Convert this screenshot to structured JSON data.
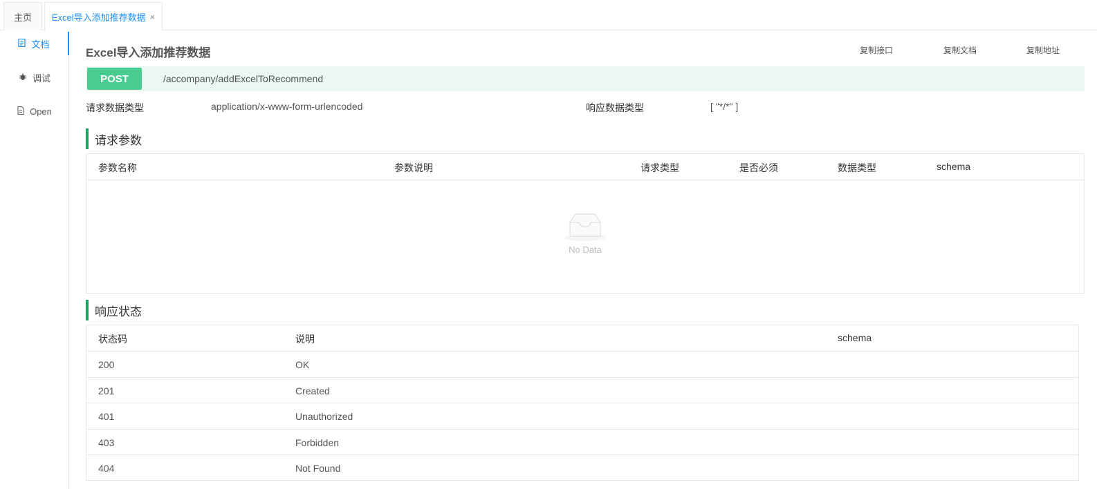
{
  "tabs": {
    "home": "主页",
    "active": "Excel导入添加推荐数据",
    "close": "×"
  },
  "sidebar": {
    "items": [
      {
        "label": "文档",
        "icon": "document-icon"
      },
      {
        "label": "调试",
        "icon": "bug-icon"
      },
      {
        "label": "Open",
        "icon": "file-icon"
      }
    ]
  },
  "api": {
    "title": "Excel导入添加推荐数据",
    "copy_interface": "复制接口",
    "copy_doc": "复制文档",
    "copy_address": "复制地址",
    "method": "POST",
    "path": "/accompany/addExcelToRecommend",
    "request_type_label": "请求数据类型",
    "request_type_value": "application/x-www-form-urlencoded",
    "response_type_label": "响应数据类型",
    "response_type_value": "[ \"*/*\" ]"
  },
  "params": {
    "heading": "请求参数",
    "columns": [
      "参数名称",
      "参数说明",
      "请求类型",
      "是否必须",
      "数据类型",
      "schema"
    ],
    "empty_text": "No Data"
  },
  "status": {
    "heading": "响应状态",
    "columns": [
      "状态码",
      "说明",
      "schema"
    ],
    "rows": [
      {
        "code": "200",
        "desc": "OK"
      },
      {
        "code": "201",
        "desc": "Created"
      },
      {
        "code": "401",
        "desc": "Unauthorized"
      },
      {
        "code": "403",
        "desc": "Forbidden"
      },
      {
        "code": "404",
        "desc": "Not Found"
      }
    ]
  },
  "colors": {
    "accent": "#1890ff",
    "post_method": "#49cc90",
    "endpoint_bg": "#eaf8f1",
    "section_bar": "#1aa260"
  }
}
